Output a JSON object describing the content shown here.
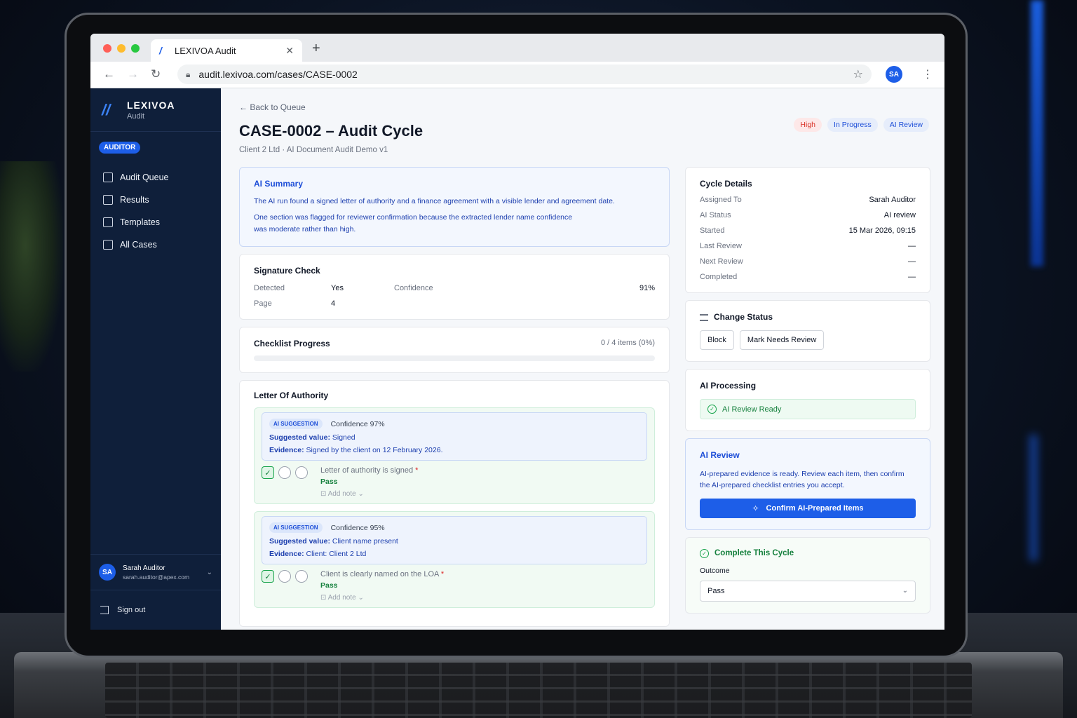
{
  "browser": {
    "tab_title": "LEXIVOA Audit",
    "url": "audit.lexivoa.com/cases/CASE-0002",
    "profile_initials": "SA"
  },
  "sidebar": {
    "brand_name": "LEXIVOA",
    "brand_sub": "Audit",
    "role": "AUDITOR",
    "items": [
      {
        "label": "Audit Queue",
        "icon": "clipboard-icon"
      },
      {
        "label": "Results",
        "icon": "check-square-icon"
      },
      {
        "label": "Templates",
        "icon": "document-icon"
      },
      {
        "label": "All Cases",
        "icon": "folder-icon"
      }
    ],
    "user": {
      "initials": "SA",
      "name": "Sarah Auditor",
      "email": "sarah.auditor@apex.com"
    },
    "signout": "Sign out"
  },
  "header": {
    "back": "Back to Queue",
    "title": "CASE-0002 – Audit Cycle",
    "subtitle": "Client 2 Ltd · AI Document Audit Demo v1",
    "badges": [
      "High",
      "In Progress",
      "AI Review"
    ]
  },
  "ai_summary": {
    "title": "AI Summary",
    "p1": "The AI run found a signed letter of authority and a finance agreement with a visible lender and agreement date.",
    "p2": "One section was flagged for reviewer confirmation because the extracted lender name confidence was moderate rather than high."
  },
  "signature_check": {
    "title": "Signature Check",
    "detected_label": "Detected",
    "detected_value": "Yes",
    "confidence_label": "Confidence",
    "confidence_value": "91%",
    "page_label": "Page",
    "page_value": "4"
  },
  "checklist_progress": {
    "title": "Checklist Progress",
    "count": "0 / 4 items (0%)",
    "progress": 0
  },
  "letter_of_authority": {
    "title": "Letter Of Authority",
    "items": [
      {
        "tag": "AI SUGGESTION",
        "confidence": "Confidence 97%",
        "suggested_label": "Suggested value:",
        "suggested_value": "Signed",
        "evidence_label": "Evidence:",
        "evidence_value": "Signed by the client on 12 February 2026.",
        "criterion": "Letter of authority is signed",
        "status": "Pass",
        "note": "Add note"
      },
      {
        "tag": "AI SUGGESTION",
        "confidence": "Confidence 95%",
        "suggested_label": "Suggested value:",
        "suggested_value": "Client name present",
        "evidence_label": "Evidence:",
        "evidence_value": "Client: Client 2 Ltd",
        "criterion": "Client is clearly named on the LOA",
        "status": "Pass",
        "note": "Add note"
      }
    ]
  },
  "cycle_details": {
    "title": "Cycle Details",
    "rows": [
      {
        "label": "Assigned To",
        "value": "Sarah Auditor"
      },
      {
        "label": "AI Status",
        "value": "AI review"
      },
      {
        "label": "Started",
        "value": "15 Mar 2026, 09:15"
      },
      {
        "label": "Last Review",
        "value": "—"
      },
      {
        "label": "Next Review",
        "value": "—"
      },
      {
        "label": "Completed",
        "value": "—"
      }
    ]
  },
  "change_status": {
    "title": "Change Status",
    "block": "Block",
    "needs_review": "Mark Needs Review"
  },
  "ai_processing": {
    "title": "AI Processing",
    "status": "AI Review Ready"
  },
  "ai_review": {
    "title": "AI Review",
    "text": "AI-prepared evidence is ready. Review each item, then confirm the AI-prepared checklist entries you accept.",
    "button": "Confirm AI-Prepared Items"
  },
  "complete_cycle": {
    "title": "Complete This Cycle",
    "outcome_label": "Outcome",
    "outcome_value": "Pass"
  },
  "colors": {
    "accent": "#1d5ee8",
    "sidebar_bg": "#0f1f3a",
    "pass_green": "#15803d",
    "high_red": "#d93025"
  }
}
